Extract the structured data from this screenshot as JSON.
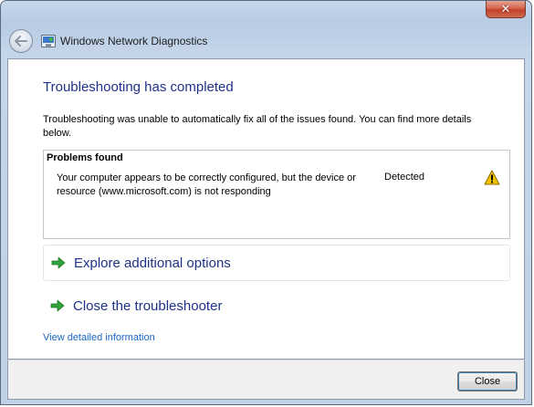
{
  "window": {
    "title": "Windows Network Diagnostics",
    "close_glyph": "✕",
    "icons": {
      "back": "back-arrow-icon",
      "app": "network-diagnostics-icon",
      "close": "close-icon"
    }
  },
  "main": {
    "heading": "Troubleshooting has completed",
    "description": "Troubleshooting was unable to automatically fix all of the issues found. You can find more details below.",
    "problems": {
      "header": "Problems found",
      "items": [
        {
          "text": "Your computer appears to be correctly configured, but the device or resource (www.microsoft.com) is not responding",
          "status": "Detected",
          "icon": "warning-icon"
        }
      ]
    },
    "options": [
      {
        "label": "Explore additional options",
        "icon": "green-arrow-icon"
      },
      {
        "label": "Close the troubleshooter",
        "icon": "green-arrow-icon"
      }
    ],
    "detail_link": "View detailed information"
  },
  "footer": {
    "close_label": "Close"
  },
  "colors": {
    "heading": "#1e3287",
    "link": "#1a66c2",
    "arrow": "#2fa33a",
    "warning": "#f5c400"
  }
}
